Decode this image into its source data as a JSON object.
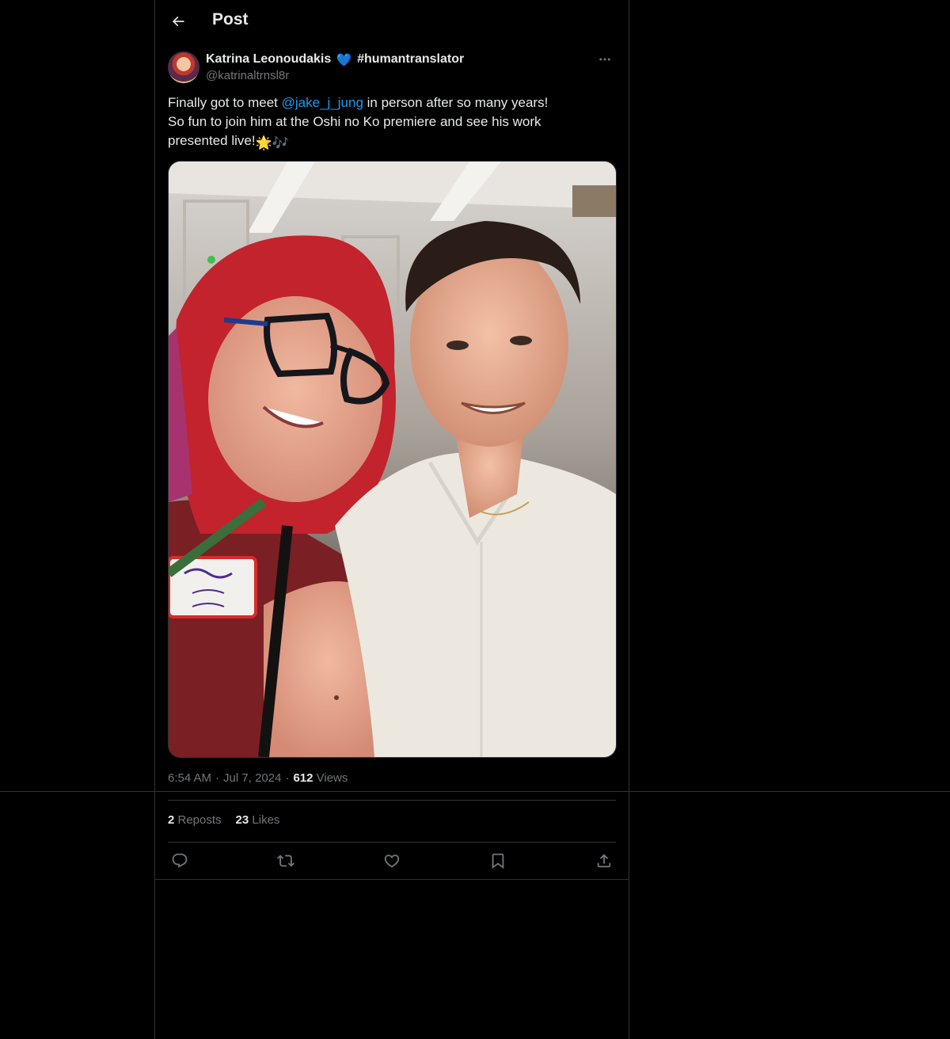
{
  "header": {
    "title": "Post",
    "back_icon": "arrow-left-icon"
  },
  "post": {
    "author": {
      "name": "Katrina Leonoudakis",
      "name_emoji": "💙",
      "hashtag": "#humantranslator",
      "handle": "@katrinaltrnsl8r"
    },
    "text": {
      "line1_before": "Finally got to meet ",
      "mention": "@jake_j_jung",
      "line1_after": " in person after so many years!",
      "line2": "So fun to join him at the Oshi no Ko premiere and see his work",
      "line3": "presented live!",
      "emoji": "🌟🎶"
    },
    "media": {
      "type": "photo"
    },
    "meta": {
      "time": "6:54 AM",
      "separator": "·",
      "date": "Jul 7, 2024",
      "views_count": "612",
      "views_label": " Views"
    },
    "stats": {
      "reposts_count": "2",
      "reposts_label": " Reposts",
      "likes_count": "23",
      "likes_label": " Likes"
    },
    "actions": [
      {
        "icon": "reply-icon"
      },
      {
        "icon": "repost-icon"
      },
      {
        "icon": "like-icon"
      },
      {
        "icon": "bookmark-icon"
      },
      {
        "icon": "share-icon"
      }
    ]
  },
  "colors": {
    "background": "#000000",
    "text": "#e7e9ea",
    "secondary": "#71767b",
    "accent": "#1d9bf0",
    "border": "#2f3336"
  }
}
